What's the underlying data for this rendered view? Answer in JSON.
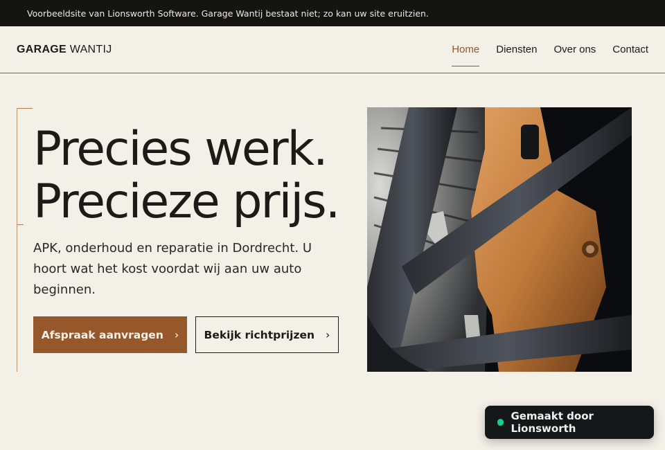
{
  "announcement": "Voorbeeldsite van Lionsworth Software. Garage Wantij bestaat niet; zo kan uw site eruitzien.",
  "brand": {
    "bold": "GARAGE",
    "light": "WANTIJ"
  },
  "nav": [
    {
      "label": "Home",
      "active": true
    },
    {
      "label": "Diensten",
      "active": false
    },
    {
      "label": "Over ons",
      "active": false
    },
    {
      "label": "Contact",
      "active": false
    }
  ],
  "hero": {
    "headline_line1": "Precies werk.",
    "headline_line2": "Precieze prijs.",
    "lead": "APK, onderhoud en reparatie in Dordrecht. U hoort wat het kost voordat wij aan uw auto beginnen.",
    "primary_cta": "Afspraak aanvragen",
    "secondary_cta": "Bekijk richtprijzen",
    "image_subject": "car wheel with copper brake caliper"
  },
  "badge": {
    "label": "Gemaakt door Lionsworth"
  },
  "colors": {
    "accent": "#96582a",
    "topbar": "#141411",
    "background": "#f3f0e8",
    "badge_dot": "#17d08f"
  }
}
